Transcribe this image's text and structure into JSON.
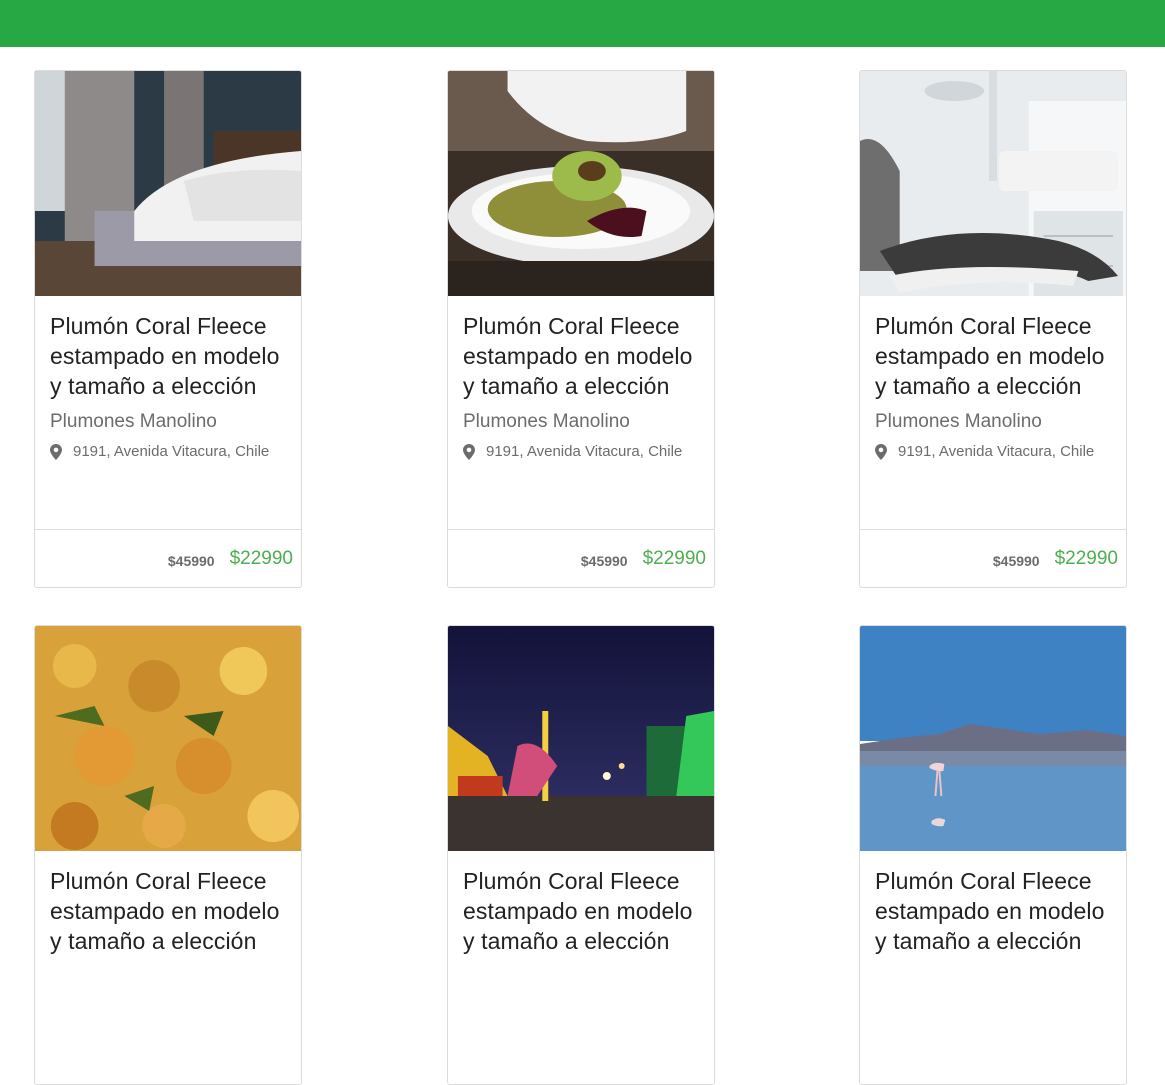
{
  "colors": {
    "header": "#28a745",
    "price_new": "#4caf50"
  },
  "cards": [
    {
      "image": "bedroom-photo",
      "title": "Plumón Coral Fleece estampado en modelo y tamaño a elección",
      "merchant": "Plumones Manolino",
      "address": "9191, Avenida Vitacura, Chile",
      "old_price": "$45990",
      "new_price": "$22990"
    },
    {
      "image": "salad-plate-photo",
      "title": "Plumón Coral Fleece estampado en modelo y tamaño a elección",
      "merchant": "Plumones Manolino",
      "address": "9191, Avenida Vitacura, Chile",
      "old_price": "$45990",
      "new_price": "$22990"
    },
    {
      "image": "dental-chair-photo",
      "title": "Plumón Coral Fleece estampado en modelo y tamaño a elección",
      "merchant": "Plumones Manolino",
      "address": "9191, Avenida Vitacura, Chile",
      "old_price": "$45990",
      "new_price": "$22990"
    },
    {
      "image": "food-dish-photo",
      "title": "Plumón Coral Fleece estampado en modelo y tamaño a elección"
    },
    {
      "image": "night-fair-photo",
      "title": "Plumón Coral Fleece estampado en modelo y tamaño a elección"
    },
    {
      "image": "flamingo-lake-photo",
      "title": "Plumón Coral Fleece estampado en modelo y tamaño a elección"
    }
  ]
}
